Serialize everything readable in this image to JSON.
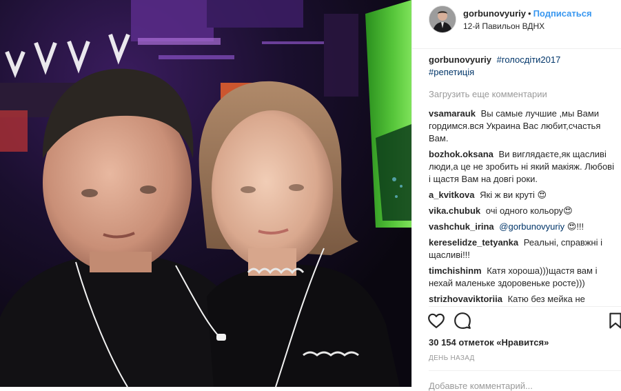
{
  "post": {
    "username": "gorbunovyuriy",
    "separator": "•",
    "follow_label": "Подписаться",
    "location": "12-й Павильон ВДНХ"
  },
  "caption": {
    "username": "gorbunovyuriy",
    "tag1": "#голосдіти2017",
    "tag2": "#репетиція"
  },
  "load_more_label": "Загрузить еще комментарии",
  "comments": [
    {
      "user": "vsamarauk",
      "text": "Вы самые лучшие ,мы Вами гордимся.вся Украина Вас любит,счастья Вам."
    },
    {
      "user": "bozhok.oksana",
      "text": "Ви виглядаєте,як щасливі люди,а це не зробить ні який макіяж. Любові і щастя Вам на довгі роки."
    },
    {
      "user": "a_kvitkova",
      "text": "Які ж ви круті 😍"
    },
    {
      "user": "vika.chubuk",
      "text": "очі одного кольору😍"
    },
    {
      "user": "vashchuk_irina",
      "mention": "@gorbunovyuriy",
      "text": "😍!!!"
    },
    {
      "user": "kereselidze_tetyanka",
      "text": "Реальні, справжні і щасливі!!!"
    },
    {
      "user": "timchishinm",
      "text": "Катя хороша)))щастя вам і нехай маленьке здоровеньке росте)))"
    },
    {
      "user": "strizhovaviktoriia",
      "text": "Катю без мейка не"
    }
  ],
  "likes_text": "30 154 отметок «Нравится»",
  "time_text": "ДЕНЬ НАЗАД",
  "add_comment_placeholder": "Добавьте комментарий...",
  "icons": {
    "like": "heart-icon",
    "comment": "speech-bubble-icon",
    "save": "bookmark-icon"
  },
  "colors": {
    "link_blue": "#3897f0",
    "hashtag": "#003569",
    "muted": "#999999",
    "text": "#262626"
  }
}
